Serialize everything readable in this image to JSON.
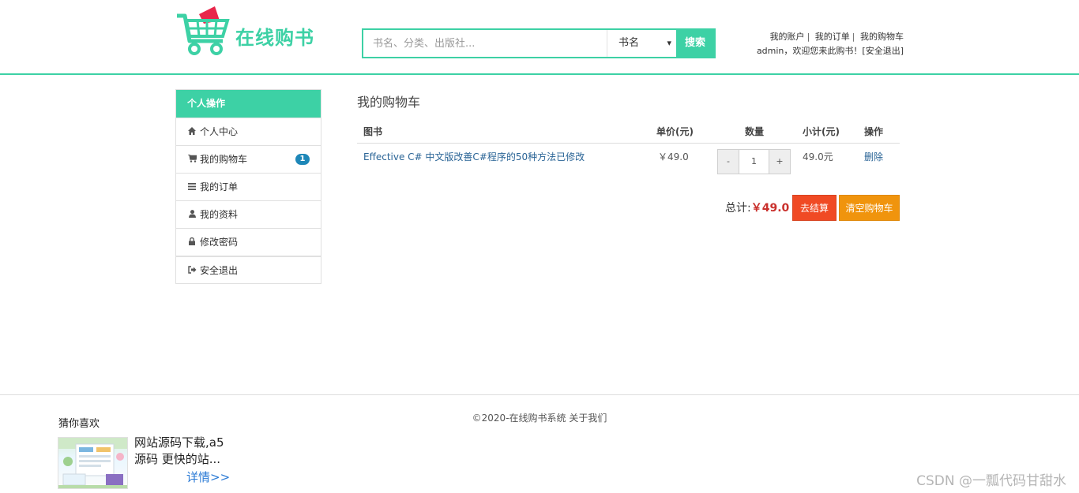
{
  "header": {
    "logo_text": "在线购书",
    "search": {
      "placeholder": "书名、分类、出版社...",
      "category": "书名",
      "button": "搜索"
    },
    "top_links": {
      "account": "我的账户",
      "orders": "我的订单",
      "cart": "我的购物车"
    },
    "welcome": "admin，欢迎您来此购书！",
    "logout": "[安全退出]"
  },
  "sidebar": {
    "title": "个人操作",
    "items": [
      {
        "label": "个人中心",
        "icon": "home-icon"
      },
      {
        "label": "我的购物车",
        "icon": "cart-icon",
        "badge": "1"
      },
      {
        "label": "我的订单",
        "icon": "list-icon"
      },
      {
        "label": "我的资料",
        "icon": "user-icon"
      },
      {
        "label": "修改密码",
        "icon": "lock-icon"
      },
      {
        "label": "安全退出",
        "icon": "sign-out-icon"
      }
    ]
  },
  "main": {
    "title": "我的购物车",
    "columns": {
      "book": "图书",
      "price": "单价(元)",
      "qty": "数量",
      "subtotal": "小计(元)",
      "action": "操作"
    },
    "rows": [
      {
        "book": "Effective C# 中文版改善C#程序的50种方法已修改",
        "price": "￥49.0",
        "qty": "1",
        "minus": "-",
        "plus": "+",
        "subtotal": "49.0元",
        "action": "删除"
      }
    ],
    "total_label": "总计:",
    "total_value": "￥49.0",
    "checkout_button": "去结算",
    "clear_button": "清空购物车"
  },
  "footer": {
    "copyright": "©2020-在线购书系统 关于我们",
    "guess_title": "猜你喜欢",
    "guess_text": "网站源码下载,a5源码 更快的站...",
    "guess_more": "详情>>",
    "watermark": "CSDN @一瓢代码甘甜水"
  },
  "colors": {
    "accent": "#3dd1a5",
    "danger": "#f04a24",
    "warning": "#f0940d",
    "link": "#2a6496",
    "price": "#c9302c"
  }
}
